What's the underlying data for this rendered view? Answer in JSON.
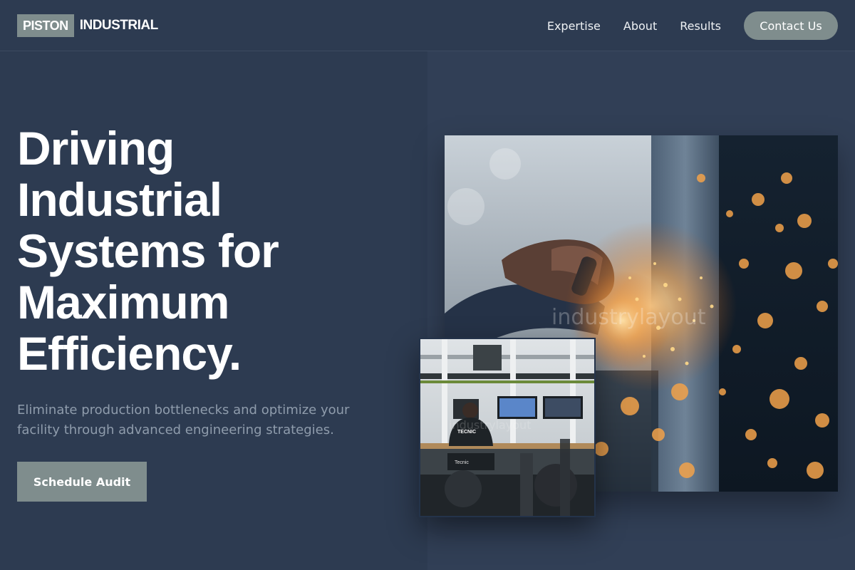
{
  "header": {
    "logo": {
      "box_text": "PISTON",
      "text": "INDUSTRIAL"
    },
    "nav": [
      {
        "label": "Expertise"
      },
      {
        "label": "About"
      },
      {
        "label": "Results"
      }
    ],
    "contact_label": "Contact Us"
  },
  "hero": {
    "headline": [
      "Driving",
      "Industrial",
      "Systems for",
      "Maximum",
      "Efficiency."
    ],
    "subtext": "Eliminate production bottlenecks and optimize your facility through advanced engineering strategies.",
    "cta_label": "Schedule Audit"
  },
  "images": {
    "large": {
      "watermark": "industrylayout"
    },
    "small": {
      "shirt_text": "TECNIC",
      "chair_text": "Tecnic",
      "watermark": "industrylayout"
    }
  },
  "colors": {
    "background": "#2d3b51",
    "accent": "#7f8d8d",
    "text_muted": "#8f9cac"
  }
}
